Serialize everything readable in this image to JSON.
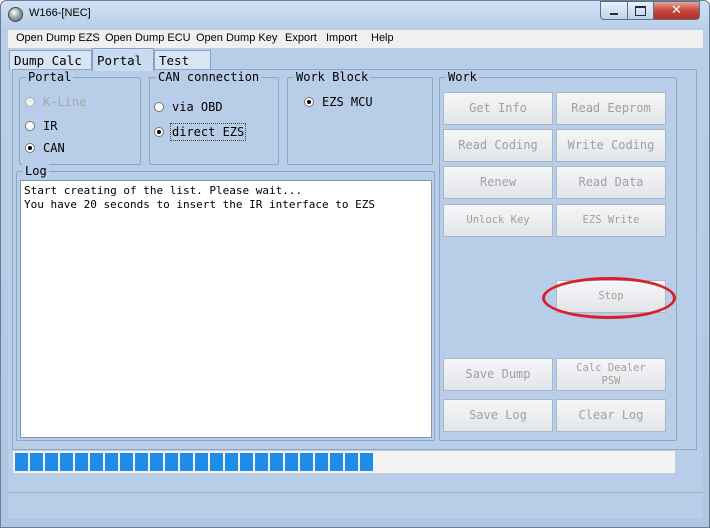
{
  "window": {
    "title": "W166-[NEC]"
  },
  "menu": [
    "Open Dump EZS",
    "Open Dump ECU",
    "Open Dump Key",
    "Export",
    "Import",
    "Help"
  ],
  "tabs": [
    "Dump Calc",
    "Portal",
    "Test"
  ],
  "active_tab": "Portal",
  "portal": {
    "label": "Portal",
    "options": [
      {
        "label": "K-Line",
        "checked": false,
        "enabled": false
      },
      {
        "label": "IR",
        "checked": false,
        "enabled": true
      },
      {
        "label": "CAN",
        "checked": true,
        "enabled": true
      }
    ]
  },
  "can": {
    "label": "CAN connection",
    "options": [
      {
        "label": "via OBD",
        "checked": false
      },
      {
        "label": "direct EZS",
        "checked": true
      }
    ]
  },
  "work_block": {
    "label": "Work Block",
    "options": [
      {
        "label": "EZS MCU",
        "checked": true
      }
    ]
  },
  "log": {
    "label": "Log",
    "lines": [
      "Start creating of the list. Please wait...",
      "You have 20 seconds to insert the IR interface to EZS"
    ]
  },
  "work": {
    "label": "Work",
    "buttons": {
      "get_info": "Get Info",
      "read_eeprom": "Read Eeprom",
      "read_coding": "Read Coding",
      "write_coding": "Write Coding",
      "renew": "Renew",
      "read_data": "Read Data",
      "unlock_key": "Unlock Key",
      "ezs_write": "EZS Write",
      "stop": "Stop",
      "save_dump": "Save Dump",
      "calc_dealer_psw": "Calc Dealer PSW",
      "save_log": "Save Log",
      "clear_log": "Clear Log"
    }
  },
  "progress": {
    "value": 0.55,
    "segments": 24,
    "color": "#1e8de8"
  },
  "colors": {
    "client_bg": "#b7cde8",
    "annotation": "#d8202a"
  },
  "icons": {
    "app": "app-icon",
    "minimize": "minimize-icon",
    "maximize": "maximize-icon",
    "close": "close-icon"
  }
}
